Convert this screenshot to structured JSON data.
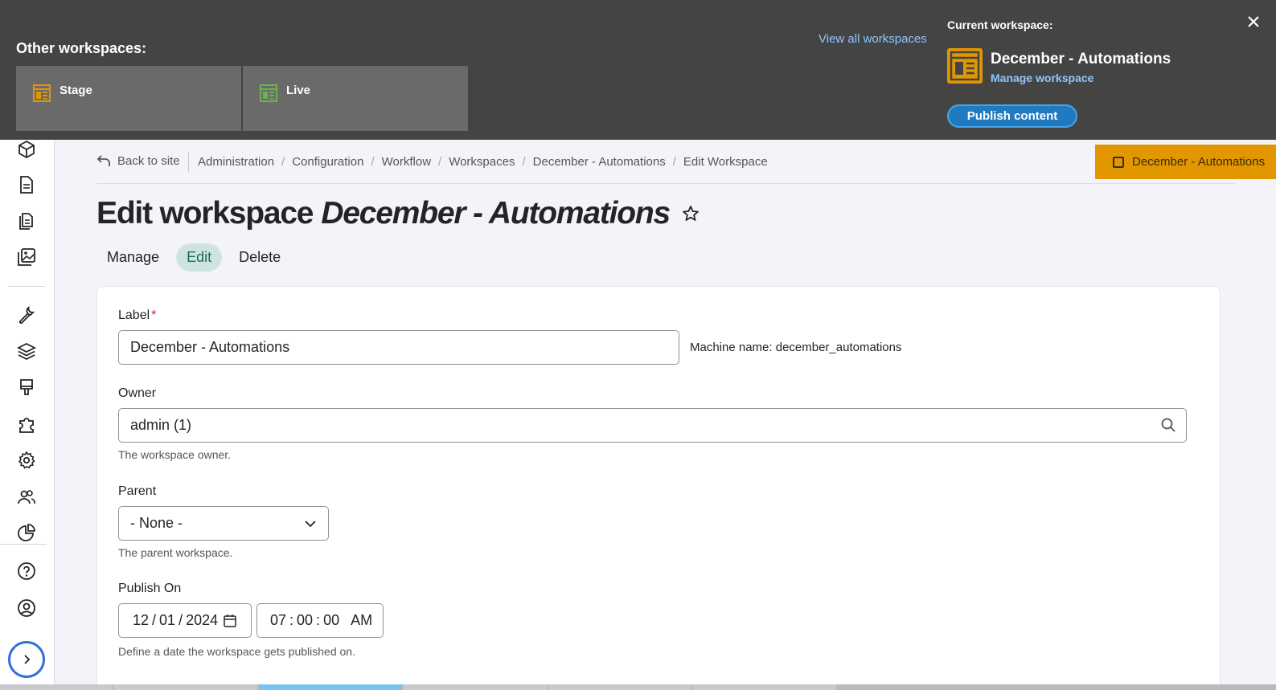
{
  "tray": {
    "other_title": "Other workspaces:",
    "tiles": [
      {
        "label": "Stage",
        "icon": "workspace-stage-icon",
        "color": "#e29700"
      },
      {
        "label": "Live",
        "icon": "workspace-live-icon",
        "color": "#6bb34f"
      }
    ],
    "view_all": "View all workspaces",
    "current_title": "Current workspace:",
    "current_name": "December - Automations",
    "manage_link": "Manage workspace",
    "publish_button": "Publish content"
  },
  "topbar": {
    "back": "Back to site",
    "breadcrumbs": [
      "Administration",
      "Configuration",
      "Workflow",
      "Workspaces",
      "December - Automations",
      "Edit Workspace"
    ],
    "workspace_badge": "December - Automations"
  },
  "page": {
    "title_prefix": "Edit workspace",
    "title_name": "December - Automations"
  },
  "tabs": [
    "Manage",
    "Edit",
    "Delete"
  ],
  "form": {
    "label_field": {
      "label": "Label",
      "required": "*",
      "value": "December - Automations",
      "machine_name": "Machine name: december_automations"
    },
    "owner_field": {
      "label": "Owner",
      "value": "admin (1)",
      "help": "The workspace owner."
    },
    "parent_field": {
      "label": "Parent",
      "value": "- None -",
      "help": "The parent workspace."
    },
    "publish_on": {
      "label": "Publish On",
      "month": "12",
      "day": "01",
      "year": "2024",
      "hour": "07",
      "minute": "00",
      "second": "00",
      "ampm": "AM",
      "help": "Define a date the workspace gets published on."
    }
  },
  "colors": {
    "accent": "#e29700",
    "link": "#8ec7ff",
    "primary_button": "#1f7ac0",
    "active_tab": "#cfe4e0"
  }
}
